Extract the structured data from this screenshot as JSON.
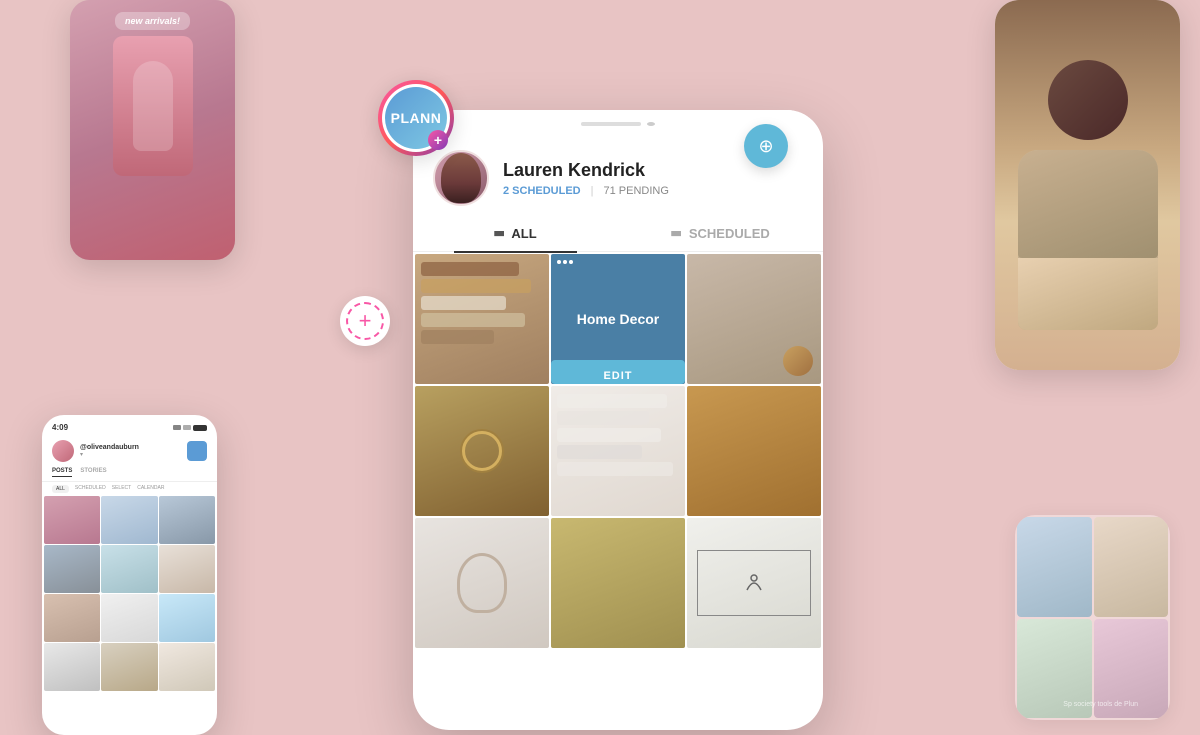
{
  "background_color": "#e8c4c4",
  "plann_logo": {
    "text": "PLANN",
    "plus": "+"
  },
  "profile": {
    "name": "Lauren Kendrick",
    "scheduled_count": "2 SCHEDULED",
    "pending_count": "71 PENDING",
    "divider": "|"
  },
  "tabs": {
    "all": "ALL",
    "scheduled": "SCHEDULED"
  },
  "grid": {
    "home_decor_label": "Home Decor",
    "edit_label": "EDIT",
    "dots": "..."
  },
  "left_phone_small": {
    "banner": "new arrivals!"
  },
  "left_phone_grid": {
    "time": "4:09",
    "profile_name": "@oliveandauburn",
    "tab_posts": "POSTS",
    "tab_stories": "STORIES",
    "subtab_all": "ALL",
    "subtab_scheduled": "SCHEDULED",
    "subtab_select": "SELECT",
    "subtab_calendar": "CALENDAR"
  },
  "society_tag": "Sp society tools de Plun",
  "zoom_icon": "🔍",
  "add_icon": "+"
}
